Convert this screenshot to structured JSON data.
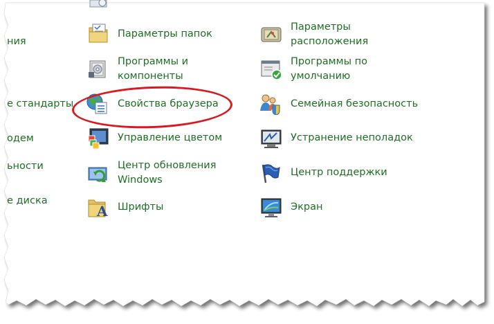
{
  "left_column": [
    "ния",
    "е стандарты",
    "одем",
    "ьности",
    "е диска"
  ],
  "middle_column": [
    {
      "label_lines": [
        "Параметры папок"
      ],
      "icon": "folder-options-icon"
    },
    {
      "label_lines": [
        "Программы и",
        "компоненты"
      ],
      "icon": "programs-features-icon"
    },
    {
      "label_lines": [
        "Свойства браузера"
      ],
      "icon": "internet-options-icon"
    },
    {
      "label_lines": [
        "Управление цветом"
      ],
      "icon": "color-management-icon"
    },
    {
      "label_lines": [
        "Центр обновления",
        "Windows"
      ],
      "icon": "windows-update-icon"
    },
    {
      "label_lines": [
        "Шрифты"
      ],
      "icon": "fonts-icon"
    }
  ],
  "right_column": [
    {
      "label_lines": [
        "Параметры",
        "расположения"
      ],
      "icon": "location-settings-icon"
    },
    {
      "label_lines": [
        "Программы по",
        "умолчанию"
      ],
      "icon": "default-programs-icon"
    },
    {
      "label_lines": [
        "Семейная безопасность"
      ],
      "icon": "family-safety-icon"
    },
    {
      "label_lines": [
        "Устранение неполадок"
      ],
      "icon": "troubleshooting-icon"
    },
    {
      "label_lines": [
        "Центр поддержки"
      ],
      "icon": "action-center-icon"
    },
    {
      "label_lines": [
        "Экран"
      ],
      "icon": "display-icon"
    }
  ],
  "colors": {
    "link_green": "#1e6e23",
    "highlight_red": "#d8191f"
  }
}
